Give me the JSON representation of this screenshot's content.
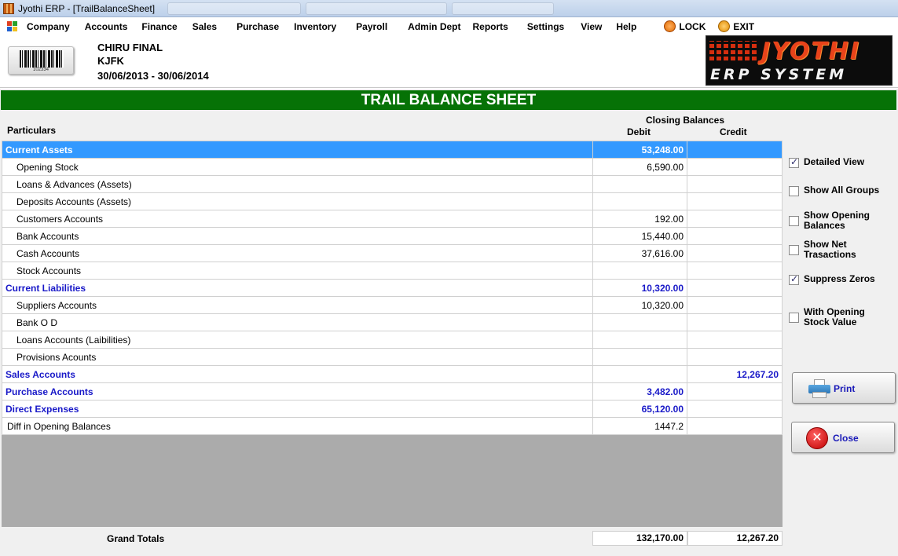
{
  "window": {
    "title": "Jyothi ERP - [TrailBalanceSheet]"
  },
  "menu": {
    "items": [
      "Company",
      "Accounts",
      "Finance",
      "Sales",
      "Purchase",
      "Inventory",
      "Payroll",
      "Admin Dept",
      "Reports",
      "Settings",
      "View",
      "Help"
    ],
    "lock_label": "LOCK",
    "exit_label": "EXIT"
  },
  "header": {
    "company_name": "CHIRU FINAL",
    "company_code": "KJFK",
    "period": "30/06/2013 - 30/06/2014",
    "logo_line1": "JYOTHI",
    "logo_line2": "ERP SYSTEM"
  },
  "report": {
    "title": "TRAIL BALANCE SHEET",
    "col_particulars": "Particulars",
    "col_closing": "Closing Balances",
    "col_debit": "Debit",
    "col_credit": "Credit",
    "rows": [
      {
        "type": "group",
        "label": "Current Assets",
        "debit": "53,248.00",
        "credit": "",
        "selected": true
      },
      {
        "type": "sub",
        "label": "Opening Stock",
        "debit": "6,590.00",
        "credit": ""
      },
      {
        "type": "sub",
        "label": "Loans & Advances (Assets)",
        "debit": "",
        "credit": ""
      },
      {
        "type": "sub",
        "label": "Deposits Accounts (Assets)",
        "debit": "",
        "credit": ""
      },
      {
        "type": "sub",
        "label": "Customers Accounts",
        "debit": "192.00",
        "credit": ""
      },
      {
        "type": "sub",
        "label": "Bank Accounts",
        "debit": "15,440.00",
        "credit": ""
      },
      {
        "type": "sub",
        "label": "Cash Accounts",
        "debit": "37,616.00",
        "credit": ""
      },
      {
        "type": "sub",
        "label": "Stock Accounts",
        "debit": "",
        "credit": ""
      },
      {
        "type": "group",
        "label": "Current Liabilities",
        "debit": "10,320.00",
        "credit": ""
      },
      {
        "type": "sub",
        "label": "Suppliers Accounts",
        "debit": "10,320.00",
        "credit": ""
      },
      {
        "type": "sub",
        "label": "Bank O D",
        "debit": "",
        "credit": ""
      },
      {
        "type": "sub",
        "label": "Loans Accounts (Laibilities)",
        "debit": "",
        "credit": ""
      },
      {
        "type": "sub",
        "label": "Provisions Acounts",
        "debit": "",
        "credit": ""
      },
      {
        "type": "group",
        "label": "Sales Accounts",
        "debit": "",
        "credit": "12,267.20"
      },
      {
        "type": "group",
        "label": "Purchase Accounts",
        "debit": "3,482.00",
        "credit": ""
      },
      {
        "type": "group",
        "label": "Direct Expenses",
        "debit": "65,120.00",
        "credit": ""
      },
      {
        "type": "diff",
        "label": "Diff in Opening Balances",
        "debit": "1447.2",
        "credit": ""
      }
    ],
    "grand_totals_label": "Grand Totals",
    "grand_total_debit": "132,170.00",
    "grand_total_credit": "12,267.20"
  },
  "options": [
    {
      "label": "Detailed View",
      "checked": true
    },
    {
      "label": "Show All Groups",
      "checked": false
    },
    {
      "label": "Show Opening Balances",
      "checked": false
    },
    {
      "label": "Show Net Trasactions",
      "checked": false
    },
    {
      "label": "Suppress Zeros",
      "checked": true
    },
    {
      "label": "With Opening Stock Value",
      "checked": false
    }
  ],
  "buttons": {
    "print_label": "Print",
    "close_label": "Close"
  },
  "colors": {
    "banner": "#067206",
    "group_text": "#1919c8",
    "selected_row": "#3399ff"
  }
}
